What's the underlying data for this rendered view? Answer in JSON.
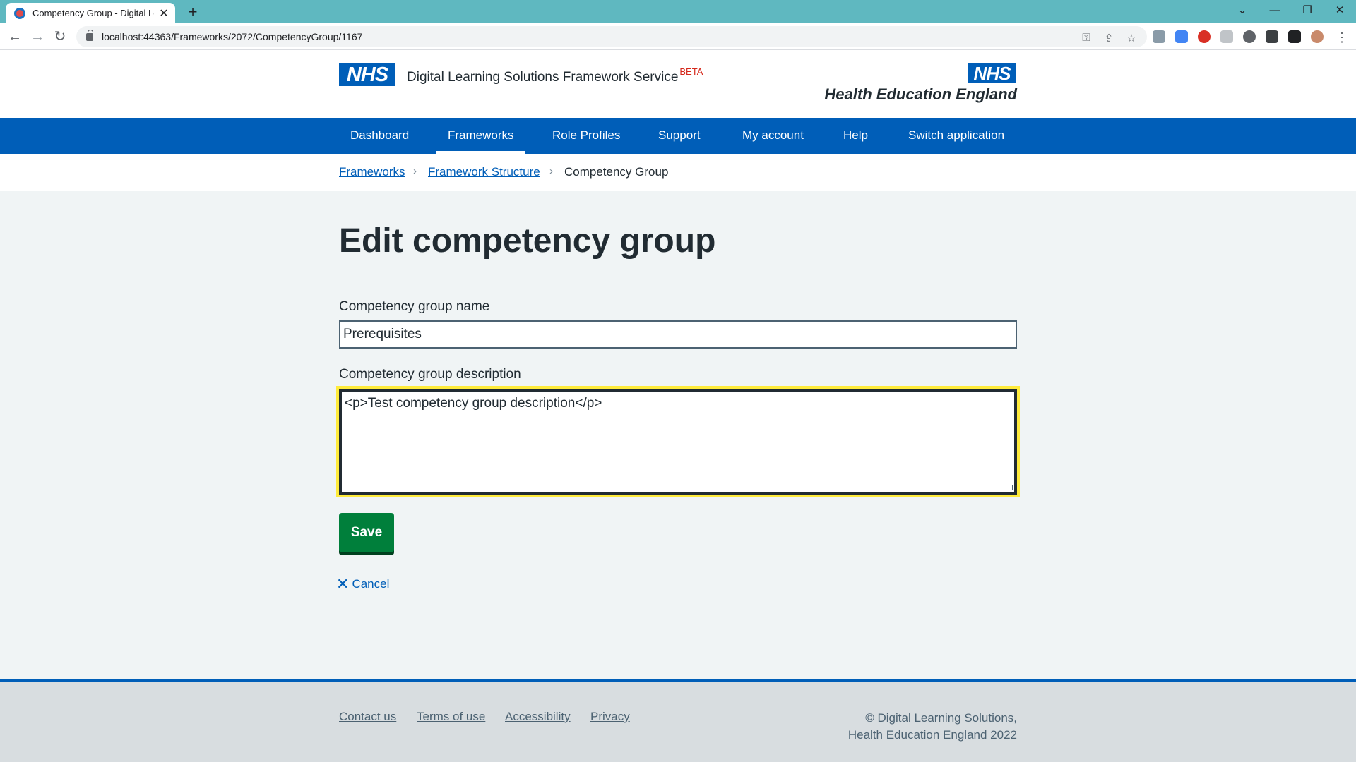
{
  "browser": {
    "tab_title": "Competency Group - Digital Lear",
    "url": "localhost:44363/Frameworks/2072/CompetencyGroup/1167",
    "icons": [
      "back-icon",
      "forward-icon",
      "reload-icon",
      "lock-icon",
      "share-icon",
      "bookmark-star-icon",
      "extensions-icon",
      "sidepanel-icon",
      "profile-icon",
      "menu-icon"
    ]
  },
  "header": {
    "nhs_logo": "NHS",
    "service_name": "Digital Learning Solutions Framework Service",
    "beta": "BETA",
    "org_logo": "NHS",
    "org_name": "Health Education England"
  },
  "nav": {
    "items": [
      {
        "label": "Dashboard",
        "active": false
      },
      {
        "label": "Frameworks",
        "active": true
      },
      {
        "label": "Role Profiles",
        "active": false
      },
      {
        "label": "Support",
        "active": false
      },
      {
        "label": "My account",
        "active": false
      },
      {
        "label": "Help",
        "active": false
      },
      {
        "label": "Switch application",
        "active": false
      }
    ]
  },
  "breadcrumb": {
    "items": [
      {
        "label": "Frameworks",
        "link": true
      },
      {
        "label": "Framework Structure",
        "link": true
      },
      {
        "label": "Competency Group",
        "link": false
      }
    ]
  },
  "page": {
    "title": "Edit competency group"
  },
  "form": {
    "name_label": "Competency group name",
    "name_value": "Prerequisites",
    "description_label": "Competency group description",
    "description_value": "<p>Test competency group description</p>",
    "save_label": "Save",
    "cancel_label": "Cancel"
  },
  "footer": {
    "links": [
      "Contact us",
      "Terms of use",
      "Accessibility",
      "Privacy"
    ],
    "copyright_line1": "© Digital Learning Solutions,",
    "copyright_line2": "Health Education England 2022"
  },
  "colors": {
    "nhs_blue": "#005eb8",
    "save_green": "#007f3b",
    "focus_yellow": "#ffeb3b",
    "tabbar": "#5fb8c0"
  }
}
